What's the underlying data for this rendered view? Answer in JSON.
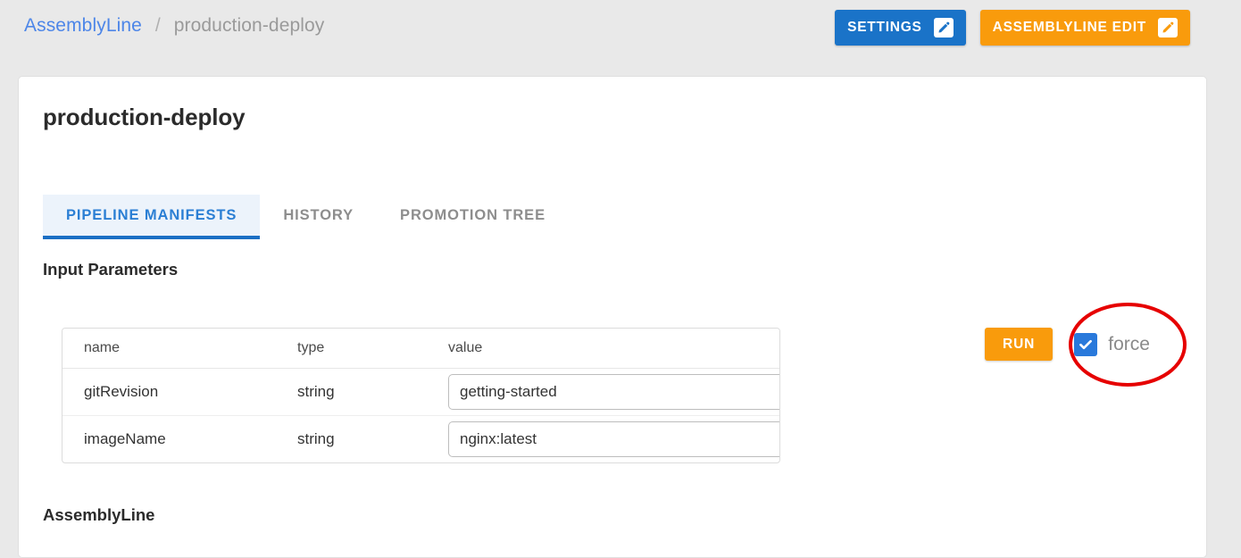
{
  "breadcrumb": {
    "root_label": "AssemblyLine",
    "separator": "/",
    "current_label": "production-deploy"
  },
  "header": {
    "settings_button": "SETTINGS",
    "assemblyline_edit_button": "ASSEMBLYLINE EDIT",
    "settings_icon": "pencil-icon",
    "assemblyline_edit_icon": "pencil-icon"
  },
  "card": {
    "title": "production-deploy"
  },
  "tabs": [
    {
      "label": "PIPELINE MANIFESTS",
      "active": true
    },
    {
      "label": "HISTORY",
      "active": false
    },
    {
      "label": "PROMOTION TREE",
      "active": false
    }
  ],
  "sections": {
    "input_parameters_heading": "Input Parameters",
    "assemblyline_heading": "AssemblyLine"
  },
  "params_table": {
    "columns": [
      "name",
      "type",
      "value"
    ],
    "rows": [
      {
        "name": "gitRevision",
        "type": "string",
        "value": "getting-started"
      },
      {
        "name": "imageName",
        "type": "string",
        "value": "nginx:latest"
      }
    ]
  },
  "run_controls": {
    "run_button": "RUN",
    "force_label": "force",
    "force_checked": true,
    "checkbox_icon": "check-icon"
  },
  "annotation": {
    "shape": "ellipse",
    "color": "#e60000",
    "target": "force-checkbox"
  },
  "colors": {
    "page_background": "#e9e9e9",
    "card_background": "#ffffff",
    "primary_blue": "#1a73c8",
    "accent_orange": "#f99b0c",
    "link_blue": "#4d86e8",
    "tab_active_blue": "#2b7fd4",
    "tab_active_bg": "#ecf3fb",
    "checkbox_blue": "#2979db",
    "annotation_red": "#e60000"
  }
}
